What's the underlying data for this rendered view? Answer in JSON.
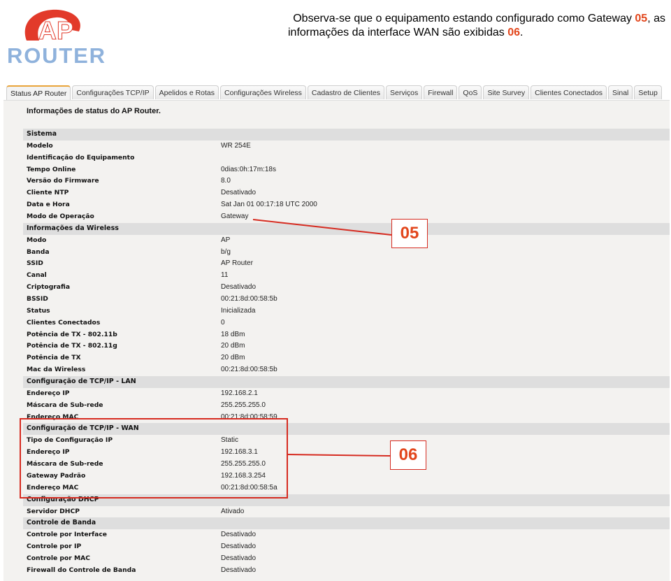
{
  "logo": {
    "text_top": "AP",
    "text_bottom": "ROUTER"
  },
  "caption": {
    "line1_pre": "Observa-se que o equipamento estando configurado como Gateway ",
    "line1_hl": "05",
    "line1_post": ", as",
    "line2_pre": "informações da interface WAN são exibidas ",
    "line2_hl": "06",
    "line2_post": "."
  },
  "tabs": [
    "Status AP Router",
    "Configurações TCP/IP",
    "Apelidos e Rotas",
    "Configurações Wireless",
    "Cadastro de Clientes",
    "Serviços",
    "Firewall",
    "QoS",
    "Site Survey",
    "Clientes Conectados",
    "Sinal",
    "Setup"
  ],
  "active_tab": "Status AP Router",
  "page_title": "Informações de status do AP Router.",
  "rows": [
    {
      "type": "section",
      "label": "Sistema"
    },
    {
      "label": "Modelo",
      "value": "WR 254E"
    },
    {
      "label": "Identificação do Equipamento",
      "value": ""
    },
    {
      "label": "Tempo Online",
      "value": "0dias:0h:17m:18s"
    },
    {
      "label": "Versão do Firmware",
      "value": "8.0"
    },
    {
      "label": "Cliente NTP",
      "value": "Desativado"
    },
    {
      "label": "Data e Hora",
      "value": "Sat Jan 01 00:17:18 UTC 2000"
    },
    {
      "label": "Modo de Operação",
      "value": "Gateway"
    },
    {
      "type": "section",
      "label": "Informações da Wireless"
    },
    {
      "label": "Modo",
      "value": "AP"
    },
    {
      "label": "Banda",
      "value": "b/g"
    },
    {
      "label": "SSID",
      "value": "AP Router"
    },
    {
      "label": "Canal",
      "value": "11"
    },
    {
      "label": "Criptografia",
      "value": "Desativado"
    },
    {
      "label": "BSSID",
      "value": "00:21:8d:00:58:5b"
    },
    {
      "label": "Status",
      "value": "Inicializada"
    },
    {
      "label": "Clientes Conectados",
      "value": "0"
    },
    {
      "label": "Potência de TX - 802.11b",
      "value": "18 dBm"
    },
    {
      "label": "Potência de TX - 802.11g",
      "value": "20 dBm"
    },
    {
      "label": "Potência de TX",
      "value": "20 dBm"
    },
    {
      "label": "Mac da Wireless",
      "value": "00:21:8d:00:58:5b"
    },
    {
      "type": "section",
      "label": "Configuração de TCP/IP - LAN"
    },
    {
      "label": "Endereço IP",
      "value": "192.168.2.1"
    },
    {
      "label": "Máscara de Sub-rede",
      "value": "255.255.255.0"
    },
    {
      "label": "Endereço MAC",
      "value": "00:21:8d:00:58:59"
    },
    {
      "type": "section",
      "label": "Configuração de TCP/IP - WAN"
    },
    {
      "label": "Tipo de Configuração IP",
      "value": "Static"
    },
    {
      "label": "Endereço IP",
      "value": "192.168.3.1"
    },
    {
      "label": "Máscara de Sub-rede",
      "value": "255.255.255.0"
    },
    {
      "label": "Gateway Padrão",
      "value": "192.168.3.254"
    },
    {
      "label": "Endereço MAC",
      "value": "00:21:8d:00:58:5a"
    },
    {
      "type": "section",
      "label": "Configuração DHCP"
    },
    {
      "label": "Servidor DHCP",
      "value": "Ativado"
    },
    {
      "type": "section",
      "label": "Controle de Banda"
    },
    {
      "label": "Controle por Interface",
      "value": "Desativado"
    },
    {
      "label": "Controle por IP",
      "value": "Desativado"
    },
    {
      "label": "Controle por MAC",
      "value": "Desativado"
    },
    {
      "label": "Firewall do Controle de Banda",
      "value": "Desativado"
    }
  ],
  "callouts": {
    "gateway": "05",
    "wan": "06"
  },
  "colors": {
    "annotation_red": "#d62b20",
    "highlight_orange": "#e2461c",
    "logo_red": "#e23a2a",
    "logo_blue": "#8fb2dc",
    "active_tab_accent": "#e9a43a"
  }
}
